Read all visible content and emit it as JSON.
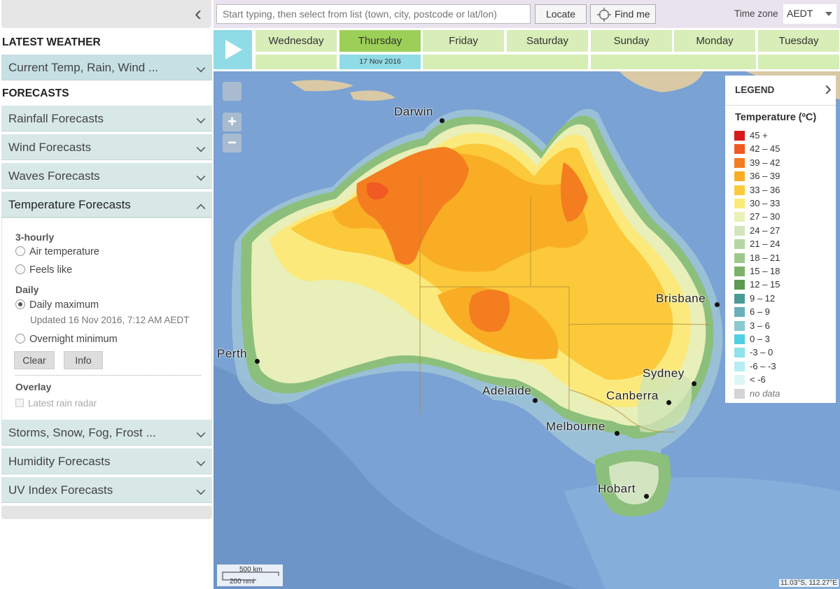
{
  "sidebar": {
    "collapse_icon": "chevron-left-icon",
    "latest_heading": "LATEST WEATHER",
    "latest_item": "Current Temp, Rain, Wind ...",
    "forecasts_heading": "FORECASTS",
    "items": [
      {
        "label": "Rainfall Forecasts"
      },
      {
        "label": "Wind Forecasts"
      },
      {
        "label": "Waves Forecasts"
      },
      {
        "label": "Temperature Forecasts"
      },
      {
        "label": "Storms, Snow, Fog, Frost ..."
      },
      {
        "label": "Humidity Forecasts"
      },
      {
        "label": "UV Index Forecasts"
      }
    ],
    "temp_panel": {
      "hourly_label": "3-hourly",
      "air_temp": "Air temperature",
      "feels_like": "Feels like",
      "daily_label": "Daily",
      "daily_max": "Daily maximum",
      "updated": "Updated 16 Nov 2016, 7:12 AM AEDT",
      "overnight_min": "Overnight minimum",
      "clear_btn": "Clear",
      "info_btn": "Info",
      "overlay_label": "Overlay",
      "rain_radar": "Latest rain radar",
      "selected": "Daily maximum"
    }
  },
  "topbar": {
    "search_placeholder": "Start typing, then select from list (town, city, postcode or lat/lon)",
    "locate": "Locate",
    "find_me": "Find me",
    "timezone_label": "Time zone",
    "timezone_value": "AEDT"
  },
  "days": {
    "items": [
      "Wednesday",
      "Thursday",
      "Friday",
      "Saturday",
      "Sunday",
      "Monday",
      "Tuesday"
    ],
    "selected": "Thursday",
    "selected_date": "17 Nov 2016"
  },
  "map": {
    "cities": [
      "Darwin",
      "Brisbane",
      "Perth",
      "Sydney",
      "Adelaide",
      "Canberra",
      "Melbourne",
      "Hobart"
    ],
    "zoom_in": "+",
    "zoom_out": "−",
    "scale_km": "500 km",
    "scale_nmi": "200 nmi",
    "coords": "11.03°S, 112.27°E"
  },
  "legend": {
    "header": "LEGEND",
    "title": "Temperature (ºC)",
    "items": [
      {
        "label": "45 +",
        "color": "#d7191c"
      },
      {
        "label": "42 – 45",
        "color": "#f05a23"
      },
      {
        "label": "39 – 42",
        "color": "#f47d20"
      },
      {
        "label": "36 – 39",
        "color": "#f9ad25"
      },
      {
        "label": "33 – 36",
        "color": "#fbcb3c"
      },
      {
        "label": "30 – 33",
        "color": "#fbea7a"
      },
      {
        "label": "27 – 30",
        "color": "#e9f0b8"
      },
      {
        "label": "24 – 27",
        "color": "#d2e5c0"
      },
      {
        "label": "21 – 24",
        "color": "#b6d7a5"
      },
      {
        "label": "18 – 21",
        "color": "#9cc98a"
      },
      {
        "label": "15 – 18",
        "color": "#7db26a"
      },
      {
        "label": "12 – 15",
        "color": "#5b9a50"
      },
      {
        "label": "9 – 12",
        "color": "#4a9b95"
      },
      {
        "label": "6 – 9",
        "color": "#68b2b8"
      },
      {
        "label": "3 – 6",
        "color": "#8bc8cf"
      },
      {
        "label": "0 – 3",
        "color": "#4fd0e3"
      },
      {
        "label": "-3 – 0",
        "color": "#8ee3ed"
      },
      {
        "label": "-6 – -3",
        "color": "#b6eef3"
      },
      {
        "label": "< -6",
        "color": "#dcf6f8"
      },
      {
        "label": "no data",
        "color": "#d4d4d4"
      }
    ]
  }
}
